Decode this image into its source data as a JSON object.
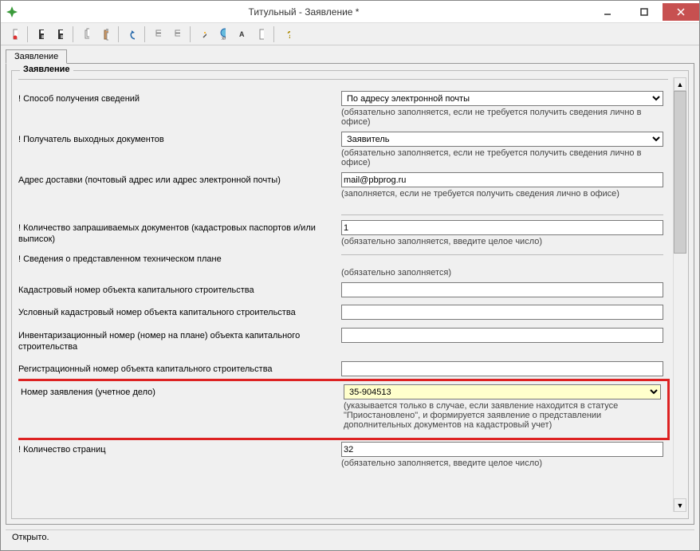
{
  "window": {
    "title": "Титульный - Заявление *"
  },
  "tab": {
    "label": "Заявление"
  },
  "legend": "Заявление",
  "form": {
    "method": {
      "label": "! Способ получения сведений",
      "value": "По адресу электронной почты",
      "hint": "(обязательно заполняется, если не требуется получить сведения лично в офисе)"
    },
    "recipient": {
      "label": "! Получатель выходных документов",
      "value": "Заявитель",
      "hint": "(обязательно заполняется, если не требуется получить сведения лично в офисе)"
    },
    "address": {
      "label": "Адрес доставки (почтовый адрес или адрес электронной почты)",
      "value": "mail@pbprog.ru",
      "hint": "(заполняется, если не требуется получить сведения лично в офисе)"
    },
    "docCount": {
      "label": "! Количество запрашиваемых документов (кадастровых паспортов и/или выписок)",
      "value": "1",
      "hint": "(обязательно заполняется, введите целое число)"
    },
    "techPlan": {
      "label": "! Сведения о представленном техническом плане",
      "hint": "(обязательно заполняется)"
    },
    "cadNum": {
      "label": "Кадастровый номер объекта капитального строительства",
      "value": ""
    },
    "condCadNum": {
      "label": "Условный кадастровый номер объекта капитального строительства",
      "value": ""
    },
    "invNum": {
      "label": "Инвентаризационный номер (номер на плане) объекта капитального строительства",
      "value": ""
    },
    "regNum": {
      "label": "Регистрационный номер объекта капитального строительства",
      "value": ""
    },
    "appNum": {
      "label": "Номер заявления (учетное дело)",
      "value": "35-904513",
      "hint": "(указывается только в случае, если заявление находится в статусе \"Приостановлено\", и формируется заявление о представлении дополнительных документов на кадастровый учет)"
    },
    "pageCount": {
      "label": "! Количество страниц",
      "value": "32",
      "hint": "(обязательно заполняется, введите целое число)"
    }
  },
  "status": "Открыто."
}
